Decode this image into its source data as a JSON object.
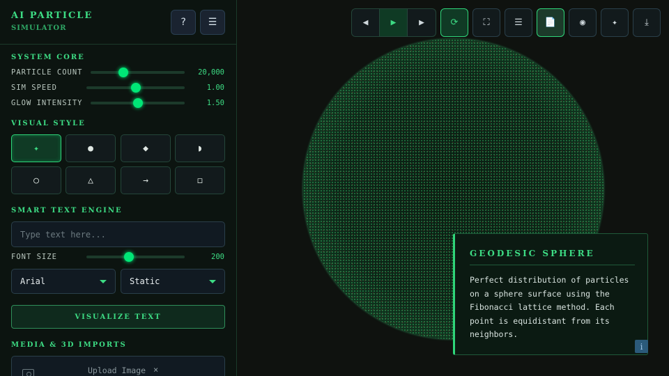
{
  "app": {
    "title": "AI PARTICLE",
    "subtitle": "SIMULATOR"
  },
  "header_buttons": {
    "help": "?",
    "menu": "☰"
  },
  "sections": {
    "system_core": "SYSTEM CORE",
    "visual_style": "VISUAL STYLE",
    "smart_text": "SMART TEXT ENGINE",
    "media": "MEDIA & 3D IMPORTS"
  },
  "sliders": {
    "particle_count": {
      "label": "PARTICLE COUNT",
      "value": "20,000",
      "level": 0.35
    },
    "sim_speed": {
      "label": "SIM SPEED",
      "value": "1.00",
      "level": 0.5
    },
    "glow_intensity": {
      "label": "GLOW INTENSITY",
      "value": "1.50",
      "level": 0.5
    },
    "font_size": {
      "label": "FONT SIZE",
      "value": "200",
      "level": 0.43
    }
  },
  "visual_styles": [
    "✦",
    "●",
    "◆",
    "◗",
    "○",
    "△",
    "→",
    "◻"
  ],
  "visual_style_active": 0,
  "text_engine": {
    "placeholder": "Type text here...",
    "font_select": "Arial",
    "mode_select": "Static",
    "visualize_label": "VISUALIZE TEXT"
  },
  "media": {
    "upload_label": "Upload Image",
    "upload_clear": "×"
  },
  "toolbar": {
    "prev": "◀",
    "play": "▶",
    "next": "▶",
    "reset": "⟳",
    "fullscreen": "⛶",
    "list": "☰",
    "doc": "📄",
    "record": "◉",
    "sparkle": "✦",
    "download": "⤓"
  },
  "info": {
    "title": "GEODESIC SPHERE",
    "body": "Perfect distribution of particles on a sphere surface using the Fibonacci lattice method. Each point is equidistant from its neighbors.",
    "badge": "i"
  },
  "colors": {
    "accent": "#3ddc84",
    "thumb": "#00e676",
    "background": "#0e110e",
    "panel": "#0c1410"
  }
}
